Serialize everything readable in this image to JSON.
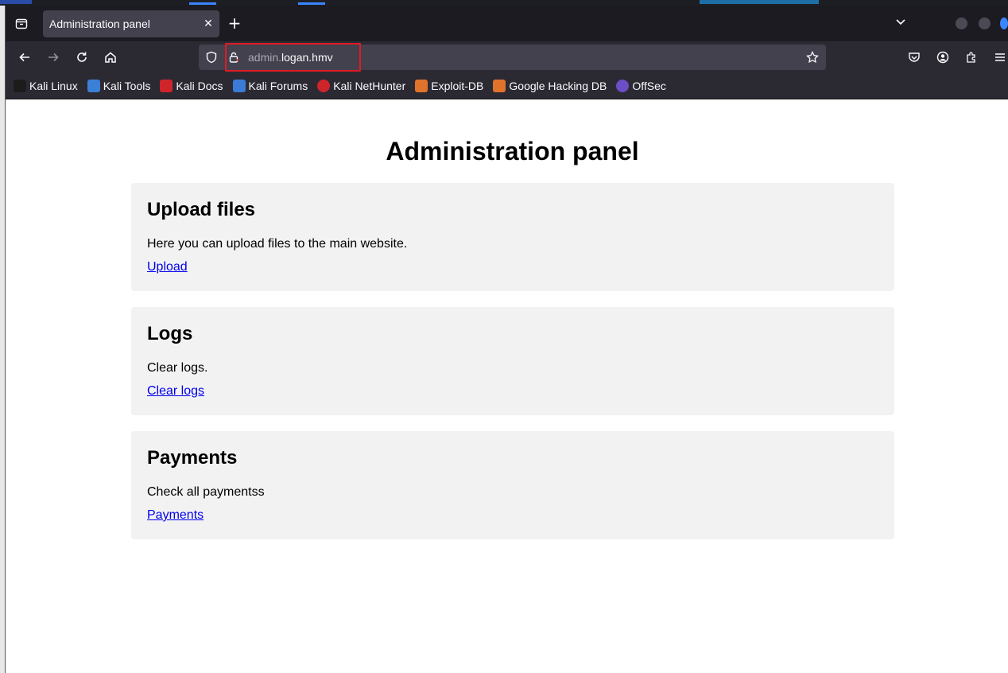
{
  "browser": {
    "tab": {
      "title": "Administration panel",
      "close_icon": "close-icon"
    },
    "url": {
      "subdomain": "admin.",
      "host": "logan.hmv"
    },
    "bookmarks": [
      {
        "label": "Kali Linux",
        "color": "#1c1c1c"
      },
      {
        "label": "Kali Tools",
        "color": "#3c7fd6"
      },
      {
        "label": "Kali Docs",
        "color": "#d0242b"
      },
      {
        "label": "Kali Forums",
        "color": "#3a7bd5"
      },
      {
        "label": "Kali NetHunter",
        "color": "#d0242b"
      },
      {
        "label": "Exploit-DB",
        "color": "#e0732c"
      },
      {
        "label": "Google Hacking DB",
        "color": "#e0732c"
      },
      {
        "label": "OffSec",
        "color": "#6c4ec7"
      }
    ],
    "highlight_color": "#e01b24"
  },
  "page": {
    "title": "Administration panel",
    "sections": [
      {
        "heading": "Upload files",
        "text": "Here you can upload files to the main website.",
        "link": "Upload"
      },
      {
        "heading": "Logs",
        "text": "Clear logs.",
        "link": "Clear logs"
      },
      {
        "heading": "Payments",
        "text": "Check all paymentss",
        "link": "Payments"
      }
    ]
  }
}
